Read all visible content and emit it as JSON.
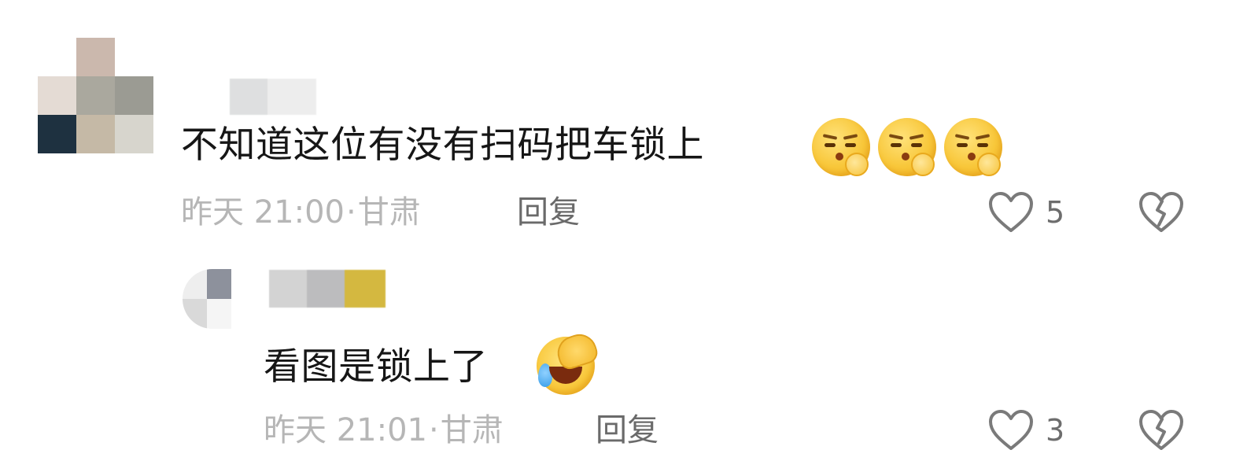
{
  "comments": [
    {
      "text": "不知道这位有没有扫码把车锁上",
      "emoji_icons": [
        "shushing-face-emoji-icon",
        "shushing-face-emoji-icon",
        "shushing-face-emoji-icon"
      ],
      "time": "昨天 21:00",
      "separator": "·",
      "location": "甘肃",
      "reply_label": "回复",
      "likes": "5",
      "like_icon": "heart-outline-icon",
      "dislike_icon": "broken-heart-icon",
      "avatar_colors": [
        "#ffffff",
        "#cbb8ad",
        "#ffffff",
        "#e4dbd4",
        "#aaa89e",
        "#9b9b93",
        "#1e3140",
        "#c5b9a6",
        "#d7d5cd"
      ],
      "name_colors": [
        "#d3d5d6",
        "#e8e8e8"
      ]
    },
    {
      "text": "看图是锁上了",
      "emoji_icon": "laughing-facepalm-emoji-icon",
      "time": "昨天 21:01",
      "separator": "·",
      "location": "甘肃",
      "reply_label": "回复",
      "likes": "3",
      "like_icon": "heart-outline-icon",
      "dislike_icon": "broken-heart-icon",
      "avatar_colors": [
        "#eeeeee",
        "#8d919c",
        "#d9d9d9",
        "#f5f5f5"
      ],
      "name_colors": [
        "#d3d3d3",
        "#bcbcbe",
        "#d4b840"
      ]
    }
  ],
  "colors": {
    "text": "#161616",
    "meta": "#b6b6b6",
    "reply": "#6a6a6a",
    "icon": "#7a7a7a"
  }
}
